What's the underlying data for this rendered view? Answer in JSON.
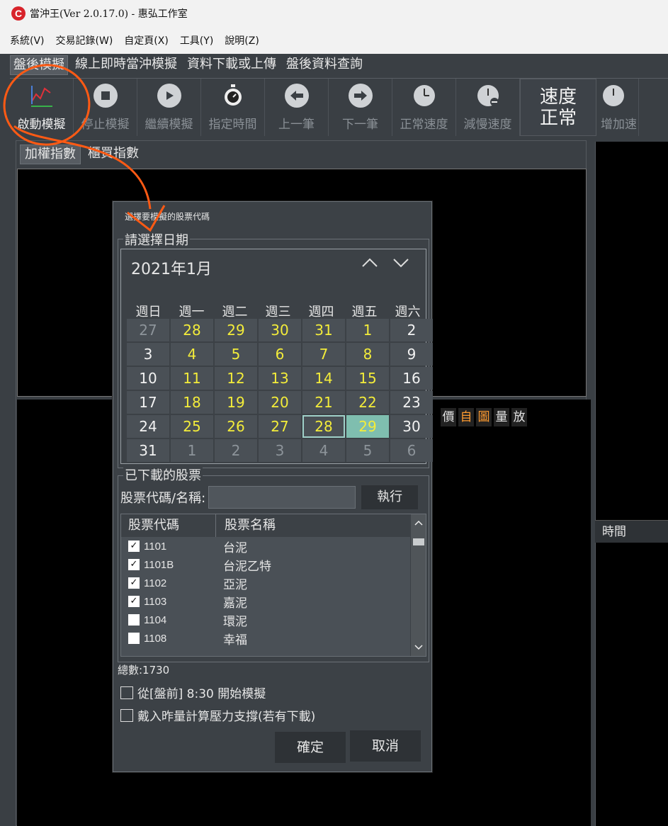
{
  "window": {
    "title": "當沖王(Ver 2.0.17.0) - 惠弘工作室",
    "logo": "C"
  },
  "menubar": [
    "系統(V)",
    "交易記錄(W)",
    "自定頁(X)",
    "工具(Y)",
    "說明(Z)"
  ],
  "tabs": [
    "盤後模擬",
    "線上即時當沖模擬",
    "資料下載或上傳",
    "盤後資料查詢"
  ],
  "toolbar": {
    "start": "啟動模擬",
    "stop": "停止模擬",
    "resume": "繼續模擬",
    "set_time": "指定時間",
    "prev": "上一筆",
    "next": "下一筆",
    "normal_speed": "正常速度",
    "slow_down": "減慢速度",
    "speed_status_1": "速度",
    "speed_status_2": "正常",
    "speed_up": "增加速"
  },
  "subtabs": [
    "加權指數",
    "櫃買指數"
  ],
  "indicators": [
    "價",
    "自",
    "圖",
    "量",
    "放"
  ],
  "time_header": "時間",
  "dialog": {
    "title": "選擇要模擬的股票代碼",
    "date_group": "請選擇日期",
    "month_label": "2021年1月",
    "weekdays": [
      "週日",
      "週一",
      "週二",
      "週三",
      "週四",
      "週五",
      "週六"
    ],
    "days": [
      {
        "d": "27",
        "t": "other"
      },
      {
        "d": "28",
        "t": "trade"
      },
      {
        "d": "29",
        "t": "trade"
      },
      {
        "d": "30",
        "t": "trade"
      },
      {
        "d": "31",
        "t": "trade"
      },
      {
        "d": "1",
        "t": "trade"
      },
      {
        "d": "2",
        "t": "normal"
      },
      {
        "d": "3",
        "t": "normal"
      },
      {
        "d": "4",
        "t": "trade"
      },
      {
        "d": "5",
        "t": "trade"
      },
      {
        "d": "6",
        "t": "trade"
      },
      {
        "d": "7",
        "t": "trade"
      },
      {
        "d": "8",
        "t": "trade"
      },
      {
        "d": "9",
        "t": "normal"
      },
      {
        "d": "10",
        "t": "normal"
      },
      {
        "d": "11",
        "t": "trade"
      },
      {
        "d": "12",
        "t": "trade"
      },
      {
        "d": "13",
        "t": "trade"
      },
      {
        "d": "14",
        "t": "trade"
      },
      {
        "d": "15",
        "t": "trade"
      },
      {
        "d": "16",
        "t": "normal"
      },
      {
        "d": "17",
        "t": "normal"
      },
      {
        "d": "18",
        "t": "trade"
      },
      {
        "d": "19",
        "t": "trade"
      },
      {
        "d": "20",
        "t": "trade"
      },
      {
        "d": "21",
        "t": "trade"
      },
      {
        "d": "22",
        "t": "trade"
      },
      {
        "d": "23",
        "t": "normal"
      },
      {
        "d": "24",
        "t": "normal"
      },
      {
        "d": "25",
        "t": "trade"
      },
      {
        "d": "26",
        "t": "trade"
      },
      {
        "d": "27",
        "t": "trade"
      },
      {
        "d": "28",
        "t": "today"
      },
      {
        "d": "29",
        "t": "selected"
      },
      {
        "d": "30",
        "t": "normal"
      },
      {
        "d": "31",
        "t": "normal"
      },
      {
        "d": "1",
        "t": "other"
      },
      {
        "d": "2",
        "t": "other"
      },
      {
        "d": "3",
        "t": "other"
      },
      {
        "d": "4",
        "t": "other"
      },
      {
        "d": "5",
        "t": "other"
      },
      {
        "d": "6",
        "t": "other"
      }
    ],
    "stock_group": "已下載的股票",
    "search_label": "股票代碼/名稱:",
    "search_value": "",
    "run_button": "執行",
    "col_code": "股票代碼",
    "col_name": "股票名稱",
    "stocks": [
      {
        "code": "1101",
        "name": "台泥",
        "checked": true
      },
      {
        "code": "1101B",
        "name": "台泥乙特",
        "checked": true
      },
      {
        "code": "1102",
        "name": "亞泥",
        "checked": true
      },
      {
        "code": "1103",
        "name": "嘉泥",
        "checked": true
      },
      {
        "code": "1104",
        "name": "環泥",
        "checked": false
      },
      {
        "code": "1108",
        "name": "幸福",
        "checked": false
      }
    ],
    "total_count": "總數:1730",
    "option_premarket": "從[盤前] 8:30 開始模擬",
    "option_load_volume": "戴入昨量計算壓力支撐(若有下載)",
    "confirm_button": "確定",
    "cancel_button": "取消"
  },
  "colors": {
    "annotation": "#ff5a14",
    "trade_day": "#f3ec3a",
    "selected_day": "#7fbeaf"
  }
}
